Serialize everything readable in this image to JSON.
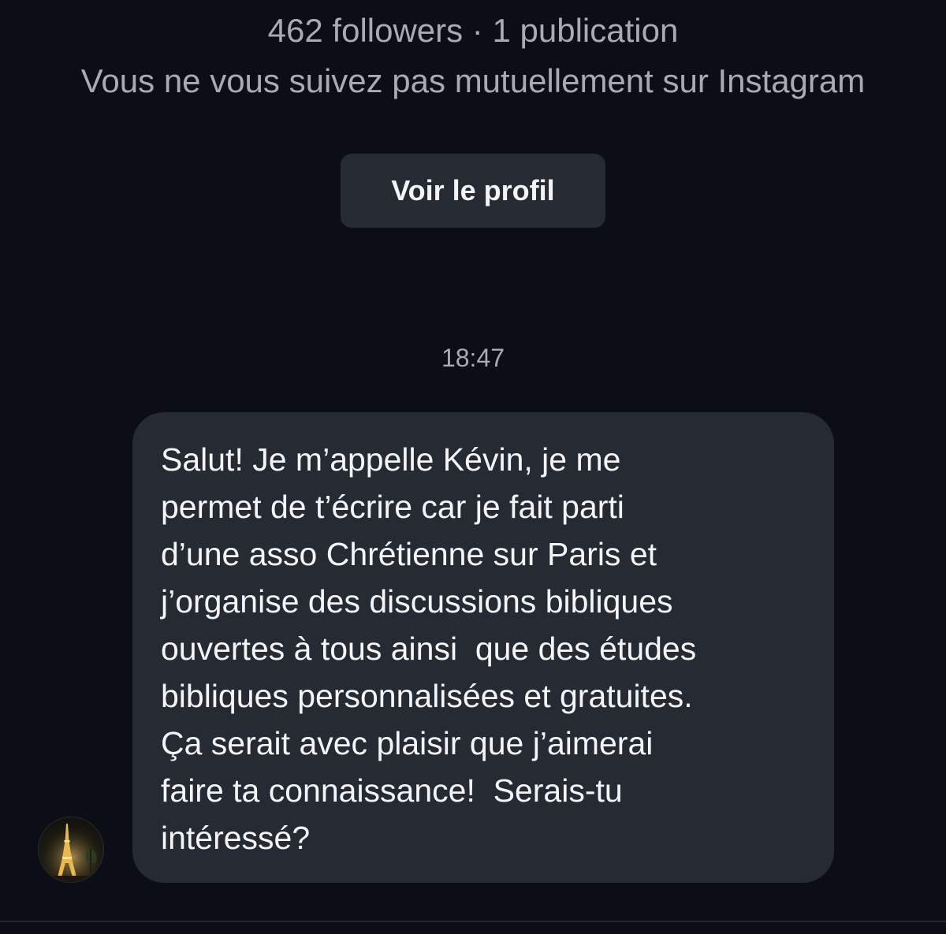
{
  "profile": {
    "stats": "462 followers · 1 publication",
    "mutual_note": "Vous ne vous suivez pas mutuellement sur Instagram",
    "view_profile_label": "Voir le profil"
  },
  "thread": {
    "timestamp": "18:47",
    "message": {
      "lines": [
        "Salut! Je m’appelle Kévin, je me",
        "permet de t’écrire car je fait parti",
        "d’une asso Chrétienne sur Paris et",
        "j’organise des discussions bibliques",
        "ouvertes à tous ainsi  que des études",
        "bibliques personnalisées et gratuites.",
        "Ça serait avec plaisir que j’aimerai",
        "faire ta connaissance!  Serais-tu",
        "intéressé?"
      ]
    },
    "sender_avatar_icon": "eiffel-tower-night-avatar"
  },
  "colors": {
    "background": "#0c0e17",
    "bubble": "#262a33",
    "secondary_text": "#a8abb4",
    "primary_text": "#f4f5f7"
  }
}
